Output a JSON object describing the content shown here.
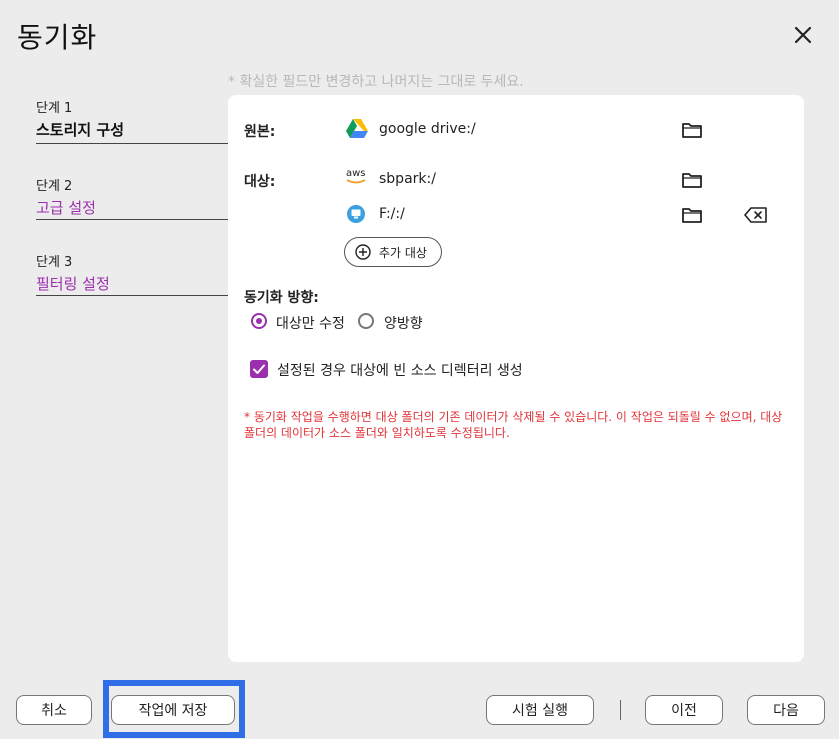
{
  "dialog": {
    "title": "동기화",
    "hint": "* 확실한 필드만 변경하고 나머지는 그대로 두세요."
  },
  "steps": [
    {
      "number": "단계 1",
      "name": "스토리지 구성"
    },
    {
      "number": "단계 2",
      "name": "고급 설정"
    },
    {
      "number": "단계 3",
      "name": "필터링 설정"
    }
  ],
  "source": {
    "label": "원본:",
    "icon": "google-drive-icon",
    "path": "google drive:/"
  },
  "target": {
    "label": "대상:",
    "items": [
      {
        "icon": "aws-icon",
        "icon_text": "aws",
        "path": "sbpark:/"
      },
      {
        "icon": "local-drive-icon",
        "path": "F:/:/"
      }
    ],
    "add_label": "추가 대상"
  },
  "direction": {
    "label": "동기화 방향:",
    "options": [
      "대상만 수정",
      "양방향"
    ],
    "selected": "대상만 수정"
  },
  "create_empty_dirs": {
    "label": "설정된 경우 대상에 빈 소스 디렉터리 생성",
    "checked": true
  },
  "warning": "* 동기화 작업을 수행하면 대상 폴더의 기존 데이터가 삭제될 수 있습니다. 이 작업은 되돌릴 수 없으며, 대상 폴더의 데이터가 소스 폴더와 일치하도록 수정됩니다.",
  "footer": {
    "cancel": "취소",
    "save": "작업에 저장",
    "test_run": "시험 실행",
    "previous": "이전",
    "next": "다음"
  },
  "colors": {
    "accent": "#9b2fae",
    "warning": "#e0343a",
    "highlight": "#2f6ee6"
  }
}
